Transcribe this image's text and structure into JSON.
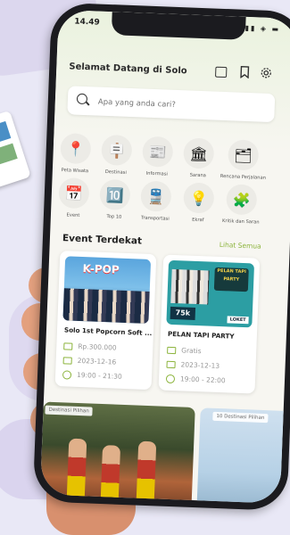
{
  "status": {
    "time": "14.49",
    "icons": "▮▮ ◈ ▬"
  },
  "header": {
    "title": "Selamat Datang di Solo"
  },
  "search": {
    "placeholder": "Apa yang anda cari?"
  },
  "categories": [
    {
      "label": "Peta Wisata",
      "icon": "map-icon",
      "glyph": "📍"
    },
    {
      "label": "Destinasi",
      "icon": "signpost-icon",
      "glyph": "🪧"
    },
    {
      "label": "Informasi",
      "icon": "info-document-icon",
      "glyph": "📰"
    },
    {
      "label": "Sarana",
      "icon": "building-icon",
      "glyph": "🏛"
    },
    {
      "label": "Rencana Perjalanan",
      "icon": "itinerary-icon",
      "glyph": "🗂"
    },
    {
      "label": "Event",
      "icon": "calendar-icon",
      "glyph": "📅"
    },
    {
      "label": "Top 10",
      "icon": "top10-badge-icon",
      "glyph": "🔟"
    },
    {
      "label": "Transportasi",
      "icon": "train-icon",
      "glyph": "🚆"
    },
    {
      "label": "Ekraf",
      "icon": "lightbulb-icon",
      "glyph": "💡"
    },
    {
      "label": "Kritik dan Saran",
      "icon": "puzzle-icon",
      "glyph": "🧩"
    }
  ],
  "events_section": {
    "title": "Event Terdekat",
    "see_all": "Lihat Semua"
  },
  "events": [
    {
      "name": "Solo 1st Popcorn Soft ...",
      "image_text": "K-POP",
      "price": "Rp.300.000",
      "date": "2023-12-16",
      "time": "19:00 - 21:30"
    },
    {
      "name": "PELAN TAPI PARTY",
      "image_text": "PELAN TAPI PARTY",
      "image_badge": "75k",
      "image_brand": "LOKET",
      "price": "Gratis",
      "date": "2023-12-13",
      "time": "19:00 - 22:00"
    }
  ],
  "destinations": {
    "label_left": "Destinasi Pilihan",
    "label_right": "10 Destinasi Pilihan"
  },
  "colors": {
    "accent": "#8cb43c",
    "background": "#f7f6f1"
  }
}
